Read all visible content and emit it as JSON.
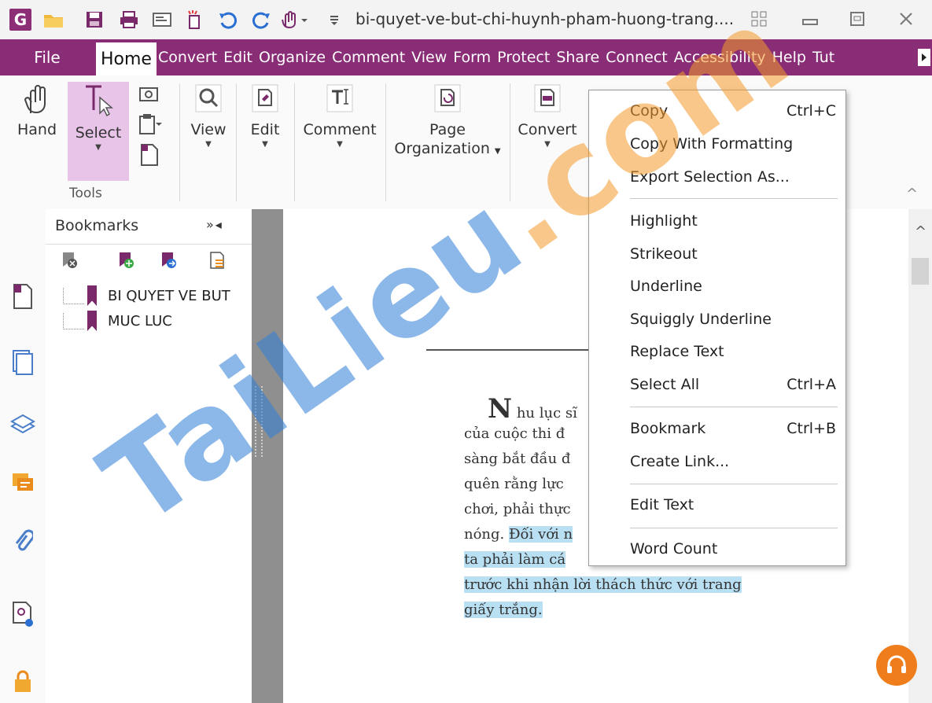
{
  "titlebar": {
    "app_logo": "G",
    "document_title": "bi-quyet-ve-but-chi-huynh-pham-huong-trang....",
    "quick_access_icons": [
      "open-folder-icon",
      "save-icon",
      "print-icon",
      "email-icon",
      "new-icon",
      "undo-icon",
      "redo-icon",
      "hand-dropdown-icon",
      "customize-icon"
    ],
    "window_buttons": [
      "restore-group-icon",
      "minimize-icon",
      "maximize-icon",
      "close-icon"
    ]
  },
  "menubar": {
    "file": "File",
    "home": "Home",
    "items": [
      "Convert",
      "Edit",
      "Organize",
      "Comment",
      "View",
      "Form",
      "Protect",
      "Share",
      "Connect",
      "Accessibility",
      "Help",
      "Tut"
    ]
  },
  "ribbon": {
    "hand": "Hand",
    "select": "Select",
    "tools_group": "Tools",
    "view": "View",
    "edit": "Edit",
    "comment": "Comment",
    "page_org_line1": "Page",
    "page_org_line2": "Organization",
    "convert": "Convert"
  },
  "bookmarks": {
    "title": "Bookmarks",
    "controls": "»◂",
    "items": [
      {
        "label": "BI QUYET VE BUT"
      },
      {
        "label": "MUC LUC"
      }
    ]
  },
  "document": {
    "dropcap": "N",
    "lines": [
      {
        "plain": "hu lục sĩ",
        "highlight": ""
      },
      {
        "plain": "của cuộc thi đ",
        "highlight": ""
      },
      {
        "plain": "sàng bắt đầu đ",
        "highlight": ""
      },
      {
        "plain": "quên rằng lực",
        "highlight": ""
      },
      {
        "plain": "chơi, phải thực",
        "highlight": ""
      },
      {
        "plain": "nóng. ",
        "highlight": "Đối với n"
      },
      {
        "plain": "",
        "highlight": "ta phải làm cá"
      },
      {
        "plain": "",
        "highlight": "trước khi nhận lời thách thức với trang"
      },
      {
        "plain": "",
        "highlight": "giấy trắng."
      }
    ]
  },
  "context_menu": {
    "items": [
      {
        "label": "Copy",
        "shortcut": "Ctrl+C"
      },
      {
        "label": "Copy With Formatting",
        "shortcut": ""
      },
      {
        "label": "Export Selection As...",
        "shortcut": ""
      },
      {
        "label": "Highlight",
        "shortcut": ""
      },
      {
        "label": "Strikeout",
        "shortcut": ""
      },
      {
        "label": "Underline",
        "shortcut": ""
      },
      {
        "label": "Squiggly Underline",
        "shortcut": ""
      },
      {
        "label": "Replace Text",
        "shortcut": ""
      },
      {
        "label": "Select All",
        "shortcut": "Ctrl+A"
      },
      {
        "label": "Bookmark",
        "shortcut": "Ctrl+B"
      },
      {
        "label": "Create Link...",
        "shortcut": ""
      },
      {
        "label": "Edit Text",
        "shortcut": ""
      },
      {
        "label": "Word Count",
        "shortcut": ""
      }
    ]
  },
  "watermark": {
    "blue": "TaiLieu",
    "orange": ".com"
  },
  "colors": {
    "menubar": "#8a2d77",
    "select_active": "#e8c4e8",
    "highlight": "#b9dff3",
    "watermark_blue": "#2f7fd8",
    "watermark_orange": "#f39a2a",
    "support_bubble": "#f07d1c"
  }
}
